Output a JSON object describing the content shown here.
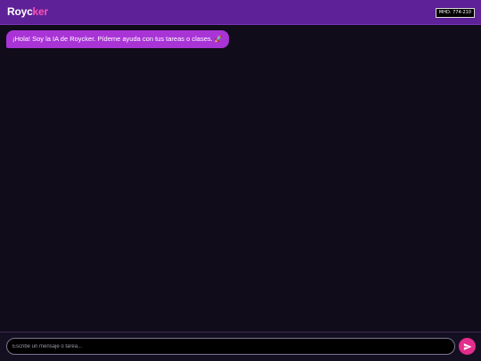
{
  "header": {
    "logo_part1": "Royc",
    "logo_part2": "ker",
    "badge": "MHD: 774-210"
  },
  "chat": {
    "messages": [
      {
        "role": "assistant",
        "text": "¡Hola! Soy la IA de Roycker. Pídeme ayuda con tus tareas o clases. 🚀"
      }
    ]
  },
  "composer": {
    "placeholder": "Escribe un mensaje o tarea...",
    "value": "",
    "send_icon": "send-icon"
  },
  "colors": {
    "header_bg": "#5e2197",
    "logo_accent": "#ff4fb8",
    "bubble_bg": "#a934d6",
    "send_bg": "#e22d8c",
    "page_bg": "#100c1a"
  }
}
